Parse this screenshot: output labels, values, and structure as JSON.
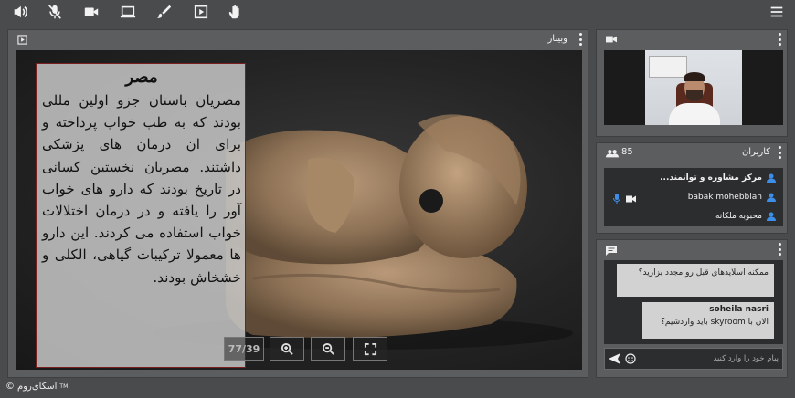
{
  "toolbar": {
    "icons": [
      "speaker-icon",
      "mic-muted-icon",
      "camera-icon",
      "screen-share-icon",
      "whiteboard-pen-icon",
      "presentation-icon",
      "raise-hand-icon",
      "menu-icon"
    ]
  },
  "main_panel": {
    "title": "وبینار",
    "slide": {
      "heading": "مصر",
      "body": "مصریان باستان جزو اولین مللی بودند که به طب خواب پرداخته و برای ان درمان های پزشکی داشتند. مصریان نخستین کسانی در تاریخ بودند که دارو های خواب آور را یافته و در درمان اختلالات خواب استفاده می کردند. این دارو ها معمولا ترکیبات گیاهی، الکلی و خشخاش بودند."
    },
    "page_counter": "77/39"
  },
  "users_panel": {
    "title": "کاربران",
    "count": "85",
    "users": [
      {
        "name": "مرکز مشاوره و توانمند..."
      },
      {
        "name": "babak mohebbian"
      },
      {
        "name": "محبوبه ملکانه"
      }
    ]
  },
  "chat_panel": {
    "messages": [
      {
        "sender": "",
        "text": "ممکنه اسلایدهای قبل رو مجدد بزارید؟"
      },
      {
        "sender": "soheila nasri",
        "text": "الان با skyroom باید وارد‌شیم؟"
      }
    ],
    "input_placeholder": "پیام خود را وارد کنید"
  },
  "footer": {
    "brand": "اسکای‌روم",
    "symbol": "©",
    "tm": "TM"
  },
  "colors": {
    "background": "#4a4b4d",
    "panel": "#5c5d5f",
    "accent_blue": "#3d8ee8"
  }
}
